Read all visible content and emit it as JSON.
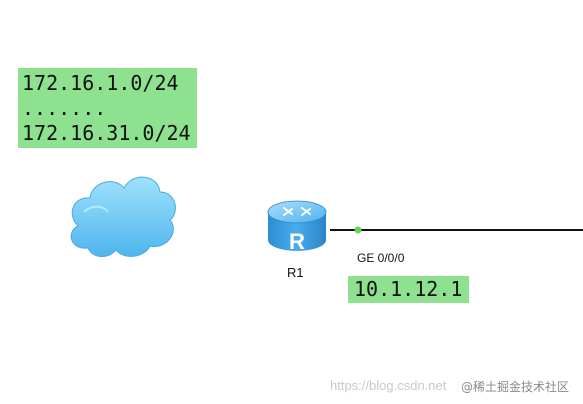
{
  "network_block": {
    "line1": "172.16.1.0/24",
    "line2": ".......",
    "line3": "172.16.31.0/24"
  },
  "router": {
    "name": "R1",
    "router_glyph": "R",
    "interface": "GE 0/0/0",
    "ip_address": "10.1.12.1"
  },
  "watermark": {
    "url": "https://blog.csdn.net",
    "brand": "@稀土掘金技术社区"
  },
  "colors": {
    "label_bg": "#8ee18e",
    "cloud_fill": "#7dd3f7",
    "router_body": "#3aa8e8",
    "link_line": "#111111",
    "port_dot": "#6ad35a"
  },
  "icons": {
    "cloud": "cloud-icon",
    "router": "router-icon"
  }
}
